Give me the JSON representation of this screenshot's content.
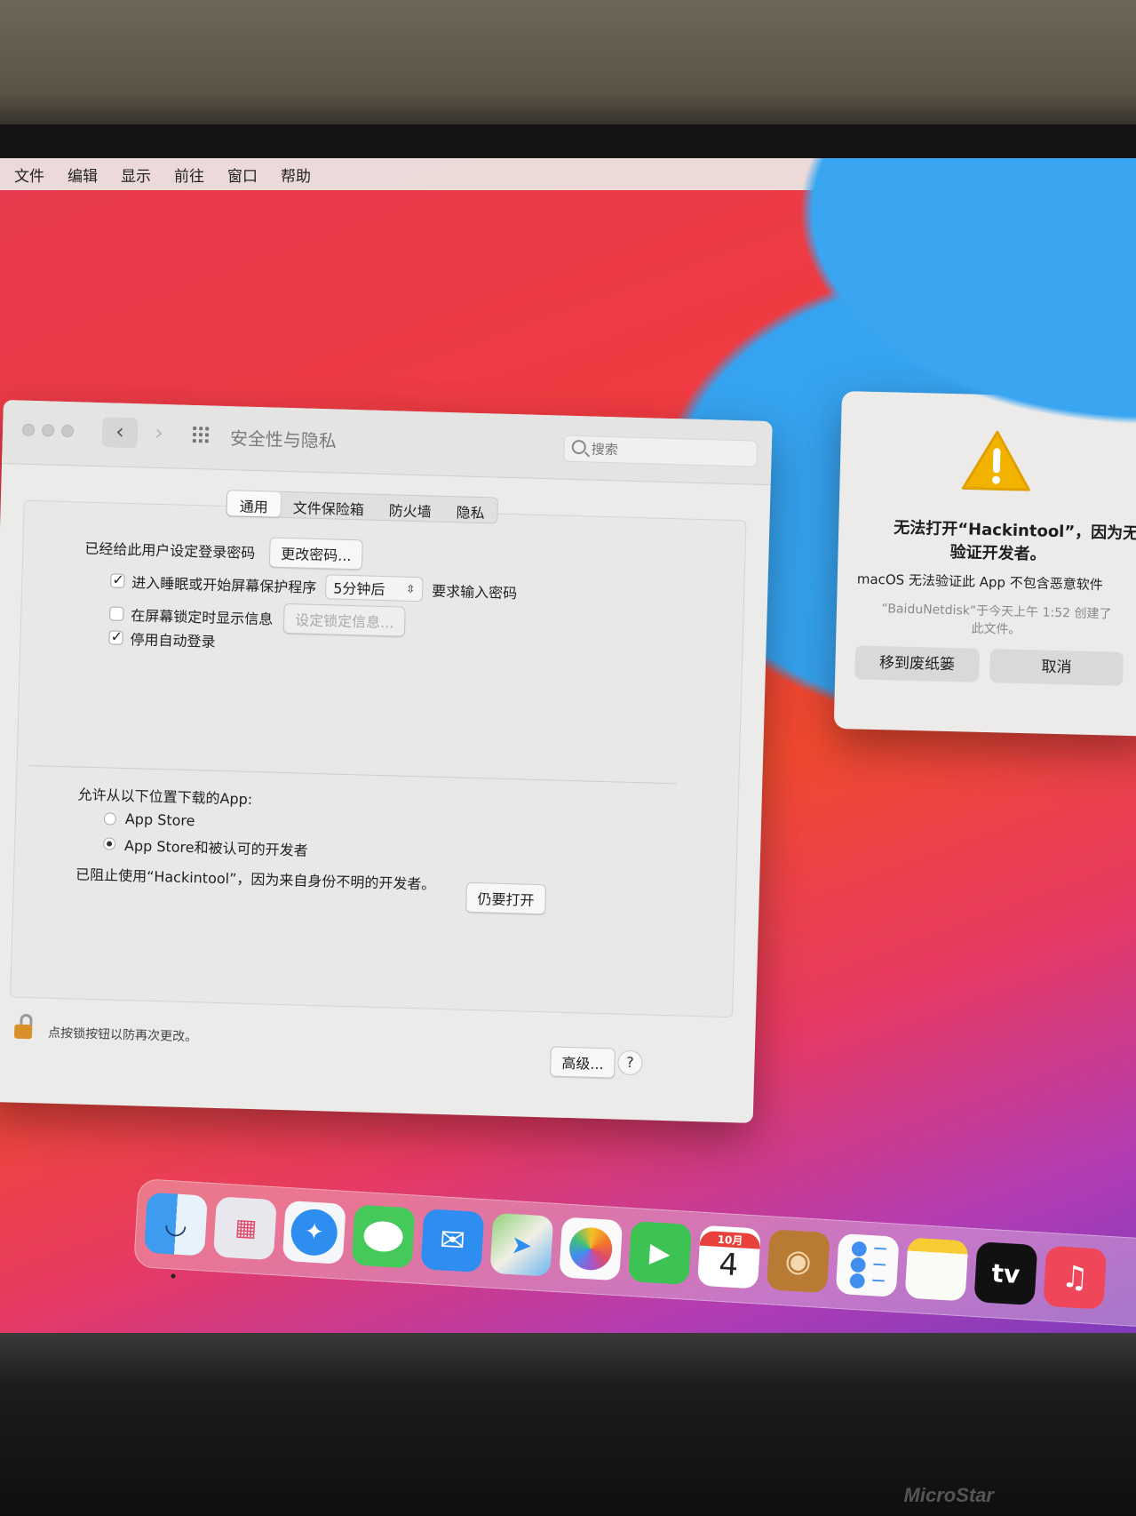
{
  "menubar": {
    "items": [
      "文件",
      "编辑",
      "显示",
      "前往",
      "窗口",
      "帮助"
    ]
  },
  "window": {
    "title": "安全性与隐私",
    "search_placeholder": "搜索",
    "tabs": [
      "通用",
      "文件保险箱",
      "防火墙",
      "隐私"
    ],
    "active_tab": "通用",
    "password_label": "已经给此用户设定登录密码",
    "change_password_button": "更改密码...",
    "require_password_prefix": "进入睡眠或开始屏幕保护程序",
    "require_password_delay": "5分钟后",
    "require_password_suffix": "要求输入密码",
    "require_password_checked": true,
    "show_message_label": "在屏幕锁定时显示信息",
    "show_message_checked": false,
    "set_lock_message_button": "设定锁定信息...",
    "disable_autologin_label": "停用自动登录",
    "disable_autologin_checked": true,
    "allow_apps_label": "允许从以下位置下载的App:",
    "radio_app_store": "App Store",
    "radio_identified": "App Store和被认可的开发者",
    "selected_radio": "radio_identified",
    "blocked_message": "已阻止使用“Hackintool”，因为来自身份不明的开发者。",
    "open_anyway_button": "仍要打开",
    "lock_hint": "点按锁按钮以防再次更改。",
    "advanced_button": "高级...",
    "help_button": "?"
  },
  "alert": {
    "title_line1": "无法打开“Hackintool”，因为无",
    "title_line2": "验证开发者。",
    "message": "macOS 无法验证此 App 不包含恶意软件",
    "sub_line1": "“BaiduNetdisk”于今天上午 1:52 创建了",
    "sub_line2": "此文件。",
    "trash_button": "移到废纸篓",
    "cancel_button": "取消"
  },
  "dock": {
    "calendar_month": "10月",
    "calendar_day": "4",
    "tv_label": "tv",
    "icons": [
      "finder-icon",
      "launchpad-icon",
      "safari-icon",
      "messages-icon",
      "mail-icon",
      "maps-icon",
      "photos-icon",
      "facetime-icon",
      "calendar-icon",
      "contacts-icon",
      "reminders-icon",
      "notes-icon",
      "appletv-icon",
      "music-icon"
    ]
  },
  "bezel": {
    "brand": "MicroStar"
  },
  "colors": {
    "warning": "#f2b200",
    "lock": "#d9902a",
    "wallpaper_red": "#ef3b41",
    "wallpaper_blue": "#36a3f0"
  }
}
